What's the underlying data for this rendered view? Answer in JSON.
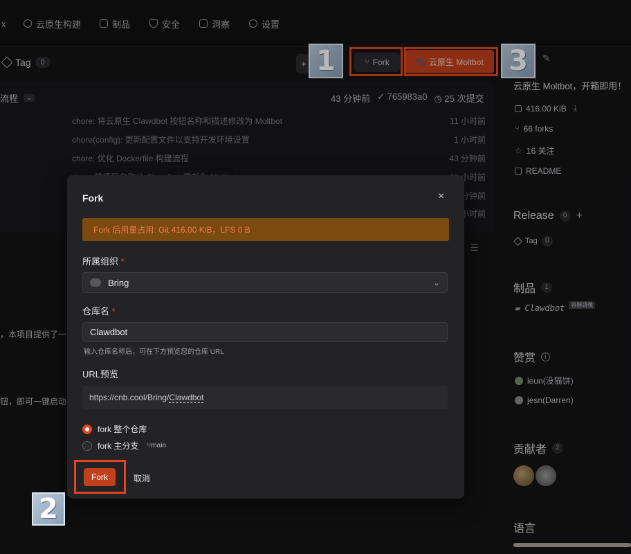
{
  "nav": {
    "items": [
      {
        "label": "",
        "icon": "tail-icon"
      },
      {
        "label": "云原生构建",
        "icon": "cloud-build-icon"
      },
      {
        "label": "制品",
        "icon": "package-icon"
      },
      {
        "label": "安全",
        "icon": "shield-icon"
      },
      {
        "label": "洞察",
        "icon": "chart-icon"
      },
      {
        "label": "设置",
        "icon": "gear-icon"
      }
    ]
  },
  "repobar": {
    "tag_label": "Tag",
    "tag_count": "0",
    "add_symbol": "+",
    "fork_label": "Fork",
    "cloud_label": "云原生 Moltbot"
  },
  "commitbar": {
    "branch_label": "流程",
    "time": "43 分钟前",
    "hash": "765983a0",
    "commits": "25 次提交",
    "rows": [
      {
        "msg": "chore: 将云原生 Clawdbot 按钮名称和描述修改为 Moltbot",
        "time": "11 小时前"
      },
      {
        "msg": "chore(config): 更新配置文件以支持开发环境设置",
        "time": "1 小时前"
      },
      {
        "msg": "chore: 优化 Dockerfile 构建流程",
        "time": "43 分钟前"
      },
      {
        "msg": "docs: 将项目名称从 Clawdbot 更新为 Moltbot",
        "time": "11 小时前"
      },
      {
        "msg": "",
        "time": "5 分钟前"
      },
      {
        "msg": "",
        "time": "5 小时前"
      }
    ]
  },
  "bg_text": {
    "line1": "，本项目提供了一",
    "line2": "钮，即可一键启动"
  },
  "callouts": {
    "n1": "1",
    "n2": "2",
    "n3": "3"
  },
  "sidebar": {
    "desc": "云原生 Moltbot，开箱即用！",
    "size": "416.00 KiB",
    "forks": "66 forks",
    "stars": "16 关注",
    "readme": "README",
    "release": {
      "title": "Release",
      "count": "0",
      "add": "+"
    },
    "release_tag": {
      "label": "Tag",
      "count": "0"
    },
    "packages": {
      "title": "制品",
      "count": "1"
    },
    "package_item": {
      "name": "Clawdbot",
      "badge": "容器镜像"
    },
    "sponsor": {
      "title": "赞赏"
    },
    "sponsors": [
      "leun(没猫饼)",
      "jesn(Darren)"
    ],
    "contributors": {
      "title": "贡献者",
      "count": "2"
    },
    "languages": {
      "title": "语言"
    }
  },
  "modal": {
    "title": "Fork",
    "close": "×",
    "warning": "Fork 后用量占用: Git 416.00 KiB，LFS 0 B",
    "org_label": "所属组织",
    "org_required": "*",
    "org_value": "Bring",
    "repo_label": "仓库名",
    "repo_required": "*",
    "repo_value": "Clawdbot",
    "repo_hint": "输入仓库名称后，可在下方预览您的仓库 URL",
    "url_label": "URL预览",
    "url_prefix": "https://cnb.cool/Bring/",
    "url_repo": "Clawdbot",
    "radio_all": "fork 整个仓库",
    "radio_main": "fork 主分支",
    "branch_tag": "main",
    "fork_button": "Fork",
    "cancel_button": "取消"
  },
  "colors": {
    "accent": "#e3461f",
    "warning_bg": "#7a4a0e",
    "warning_text": "#f07a4c"
  }
}
